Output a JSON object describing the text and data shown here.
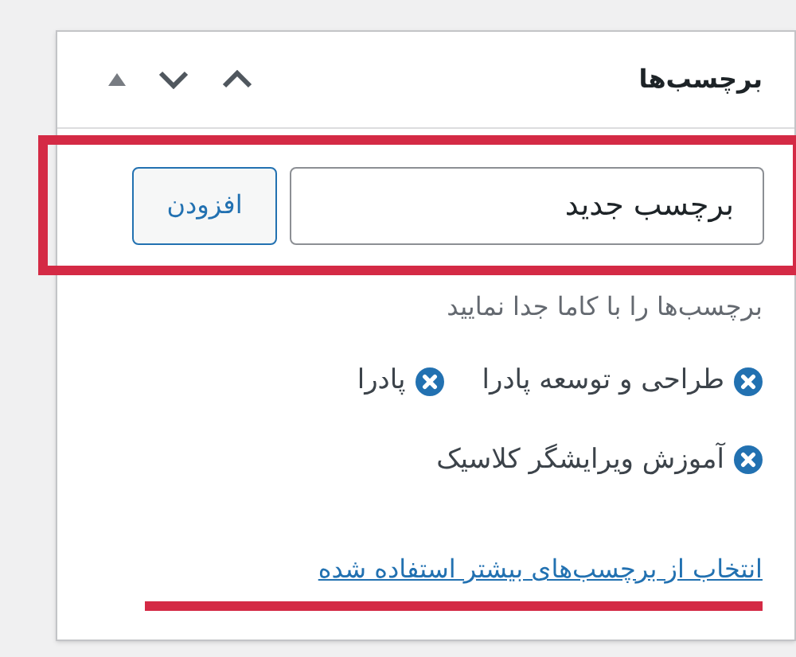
{
  "panel": {
    "title": "برچسب‌ها"
  },
  "add_tag": {
    "value": "برچسب جدید",
    "button": "افزودن"
  },
  "hint": "برچسب‌ها را با کاما جدا نمایید",
  "tags": [
    {
      "label": "طراحی و توسعه پادرا"
    },
    {
      "label": "پادرا"
    },
    {
      "label": "آموزش ویرایشگر کلاسیک"
    }
  ],
  "link": "انتخاب از برچسب‌های بیشتر استفاده شده"
}
